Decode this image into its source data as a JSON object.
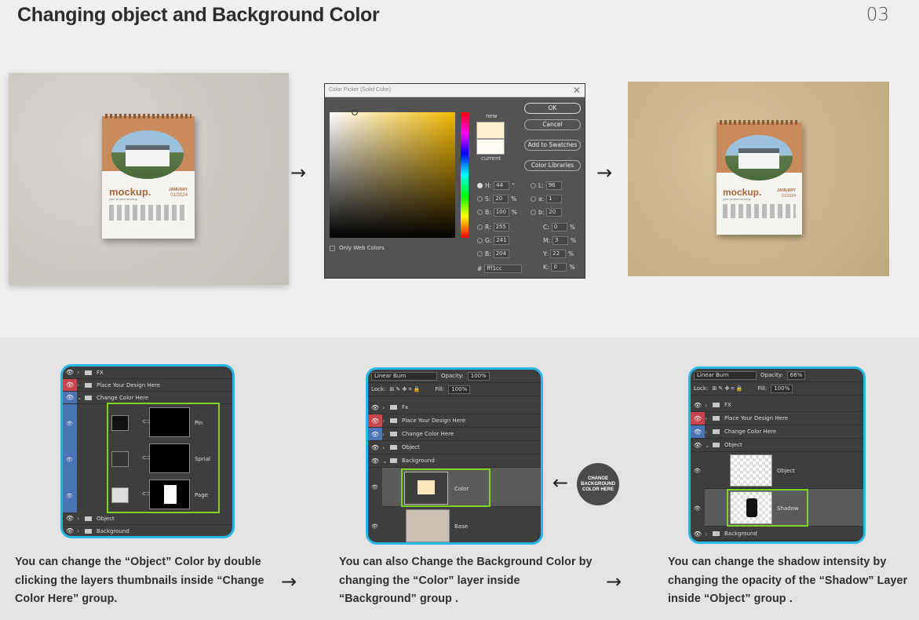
{
  "header": {
    "title": "Changing object and Background Color",
    "page_number": "03"
  },
  "arrows": {
    "glyph": "→",
    "left_glyph": "←"
  },
  "mockup": {
    "brand": "mockup.",
    "tagline": "your project mockup",
    "month": "JANUARY",
    "year": "01/2024"
  },
  "color_picker": {
    "title": "Color Picker (Solid Color)",
    "close": "✕",
    "new_label": "new",
    "current_label": "current",
    "ok": "OK",
    "cancel": "Cancel",
    "add_swatches": "Add to Swatches",
    "color_libraries": "Color Libraries",
    "only_web": "Only Web Colors",
    "hsb": [
      {
        "k": "H:",
        "v": "44",
        "u": "°"
      },
      {
        "k": "S:",
        "v": "20",
        "u": "%"
      },
      {
        "k": "B:",
        "v": "100",
        "u": "%"
      }
    ],
    "rgb": [
      {
        "k": "R:",
        "v": "255"
      },
      {
        "k": "G:",
        "v": "241"
      },
      {
        "k": "B:",
        "v": "204"
      }
    ],
    "lab": [
      {
        "k": "L:",
        "v": "96"
      },
      {
        "k": "a:",
        "v": "1"
      },
      {
        "k": "b:",
        "v": "20"
      }
    ],
    "cmyk": [
      {
        "k": "C:",
        "v": "0",
        "u": "%"
      },
      {
        "k": "M:",
        "v": "3",
        "u": "%"
      },
      {
        "k": "Y:",
        "v": "22",
        "u": "%"
      },
      {
        "k": "K:",
        "v": "0",
        "u": "%"
      }
    ],
    "hex_label": "#",
    "hex": "fff1cc",
    "new_color": "#fff1cc"
  },
  "panel1": {
    "layers": [
      "FX",
      "Place Your Design Here",
      "Change Color Here"
    ],
    "sub": [
      "Pin",
      "Sprial",
      "Page"
    ],
    "bottom": [
      "Object",
      "Background"
    ]
  },
  "panel2": {
    "blend": "Linear Burn",
    "opacity_label": "Opacity:",
    "opacity": "100%",
    "lock_label": "Lock:",
    "fill_label": "Fill:",
    "fill": "100%",
    "layers": [
      "Fx",
      "Place Your Design Here",
      "Change Color Here",
      "Object",
      "Background"
    ],
    "sub": [
      "Color",
      "Base"
    ]
  },
  "panel3": {
    "blend": "Linear Burn",
    "opacity_label": "Opacity:",
    "opacity": "66%",
    "lock_label": "Lock:",
    "fill_label": "Fill:",
    "fill": "100%",
    "layers": [
      "FX",
      "Place Your Design Here",
      "Change Color Here",
      "Object"
    ],
    "sub": [
      "Object",
      "Shadow"
    ],
    "bottom": "Background"
  },
  "badge": {
    "text": "CHANGE BACKGROUND COLOR HERE"
  },
  "captions": [
    "You  can change the “Object” Color by double clicking the layers thumbnails inside “Change Color Here” group.",
    "You  can also Change the Background Color by changing the “Color” layer inside “Background” group .",
    "You  can change the shadow intensity by changing the opacity of the “Shadow” Layer inside “Object” group ."
  ],
  "colors": {
    "highlight": "#7ed321",
    "panel_border": "#29b7e8"
  }
}
